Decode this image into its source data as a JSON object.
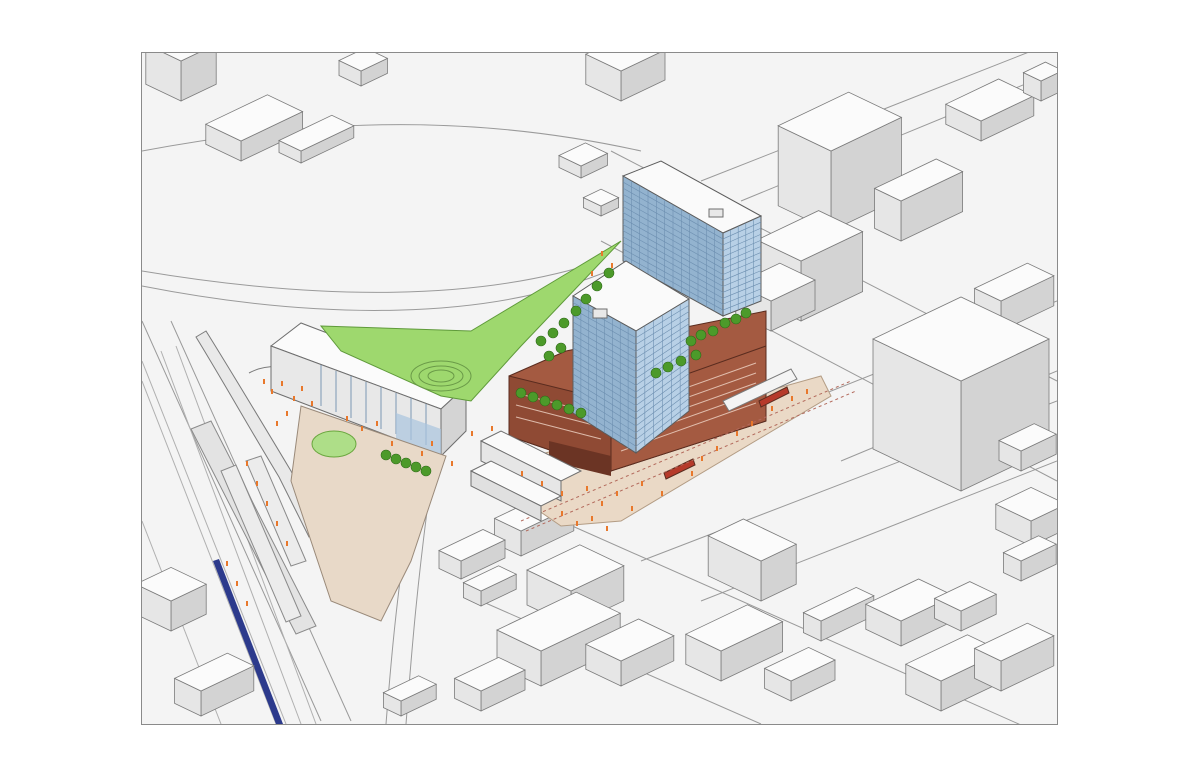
{
  "figure": {
    "type": "axonometric-site-diagram",
    "labels": [],
    "colors": {
      "background": "#ffffff",
      "ground": "#f4f4f4",
      "context_building_roof": "#fbfbfb",
      "context_building_left": "#e6e6e6",
      "context_building_right": "#d3d3d3",
      "linework": "#7a7a7a",
      "glass_tower_left": "#93b3cf",
      "glass_tower_right": "#b8d0e6",
      "brick_podium": "#8f4a34",
      "brick_podium_light": "#a45a41",
      "green_roof": "#9ed86e",
      "tree": "#4c9a2a",
      "plaza_paving": "#e8d9c8",
      "pedestrians": "#e8782c",
      "streetcar": "#b63a2a",
      "train": "#2c3a8c"
    },
    "elements": {
      "towers": [
        "north-tower",
        "south-tower"
      ],
      "podium": "brick-podium",
      "green_roof": "landscaped-green-roof",
      "plaza": "public-plaza",
      "lawn": "circular-lawn",
      "transit": [
        "rail-corridor",
        "streetcar-line",
        "commuter-train"
      ]
    }
  }
}
